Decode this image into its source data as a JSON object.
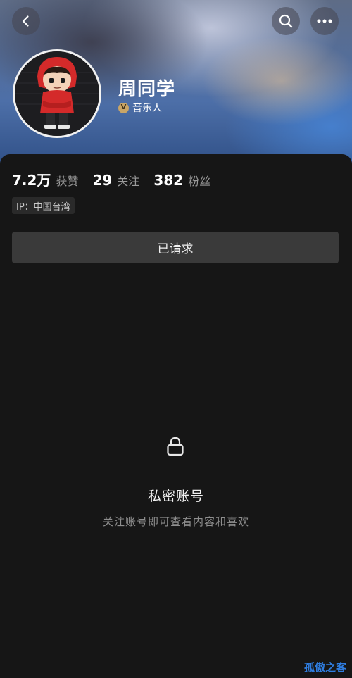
{
  "header": {
    "back_icon": "chevron-left-icon",
    "search_icon": "search-icon",
    "more_icon": "more-horizontal-icon"
  },
  "profile": {
    "name": "周同学",
    "verified_badge_letter": "V",
    "verified_label": "音乐人",
    "avatar": "cartoon-avatar-red-hoodie"
  },
  "stats": [
    {
      "value": "7.2万",
      "label": "获赞"
    },
    {
      "value": "29",
      "label": "关注"
    },
    {
      "value": "382",
      "label": "粉丝"
    }
  ],
  "ip_location": "IP：中国台湾",
  "follow_button_label": "已请求",
  "private_notice": {
    "icon": "lock-icon",
    "title": "私密账号",
    "subtitle": "关注账号即可查看内容和喜欢"
  },
  "watermark": "孤傲之客",
  "colors": {
    "page_bg": "#161616",
    "button_bg": "#3a3a3a",
    "verify_gold": "#c9a566",
    "watermark_blue": "#2f7de0"
  }
}
